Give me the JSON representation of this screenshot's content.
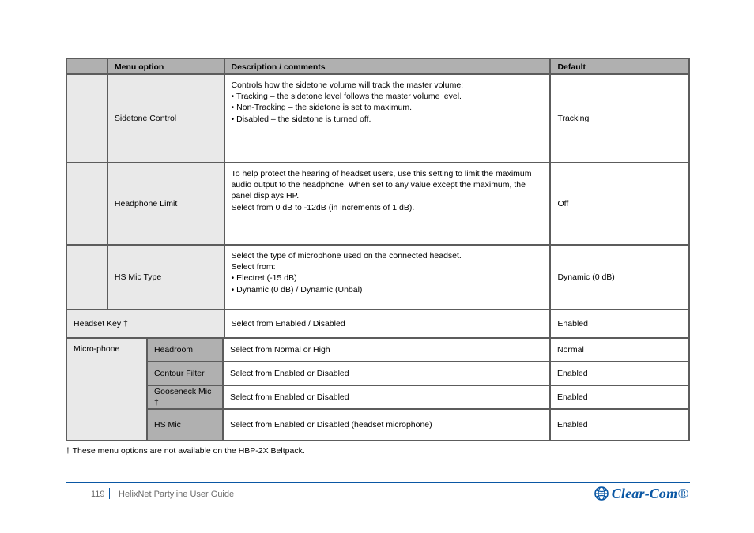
{
  "footer": {
    "page_number": "119",
    "doc_title": "HelixNet Partyline   User Guide"
  },
  "logo": {
    "text_a": "Clear",
    "hyphen": "-",
    "text_b": "Com",
    "tm": "®"
  },
  "table": {
    "headers": {
      "c1": "",
      "c2": "Menu option",
      "c3": "Description / comments",
      "c4": "Default"
    },
    "rows": [
      {
        "c1": "",
        "c2": "Sidetone Control",
        "c3": "Controls how the sidetone volume will track the master volume:\n• Tracking – the sidetone level follows the master volume level.\n• Non-Tracking – the sidetone is set to maximum.\n• Disabled – the sidetone is turned off.",
        "c4": "Tracking"
      },
      {
        "c1": "",
        "c2": "Headphone Limit",
        "c3": "To help protect the hearing of headset users, use this setting to limit the maximum audio output to the headphone. When set to any value except the maximum, the panel displays HP.\nSelect from 0 dB to -12dB (in increments of 1 dB).",
        "c4": "Off"
      },
      {
        "c1": "",
        "c2": "HS Mic Type",
        "c3": "Select the type of microphone used on the connected headset.\nSelect from:\n• Electret (-15 dB)\n• Dynamic (0 dB) / Dynamic (Unbal)",
        "c4": "Dynamic (0 dB)"
      },
      {
        "c1": "",
        "c2": "Headset Key †",
        "c3": "Select from Enabled / Disabled",
        "c4": "Enabled"
      },
      {
        "c1": "Micro-phone",
        "sub": [
          {
            "label": "Headroom",
            "c3": "Select from Normal or High",
            "c4": "Normal"
          },
          {
            "label": "Contour Filter",
            "c3": "Select from Enabled or Disabled",
            "c4": "Enabled"
          },
          {
            "label": "Gooseneck Mic †",
            "c3": "Select from Enabled or Disabled",
            "c4": "Enabled"
          },
          {
            "label": "HS Mic",
            "c3": "Select from Enabled or Disabled (headset microphone)",
            "c4": "Enabled"
          }
        ]
      }
    ],
    "footnote": "† These menu options are not available on the HBP-2X Beltpack."
  }
}
